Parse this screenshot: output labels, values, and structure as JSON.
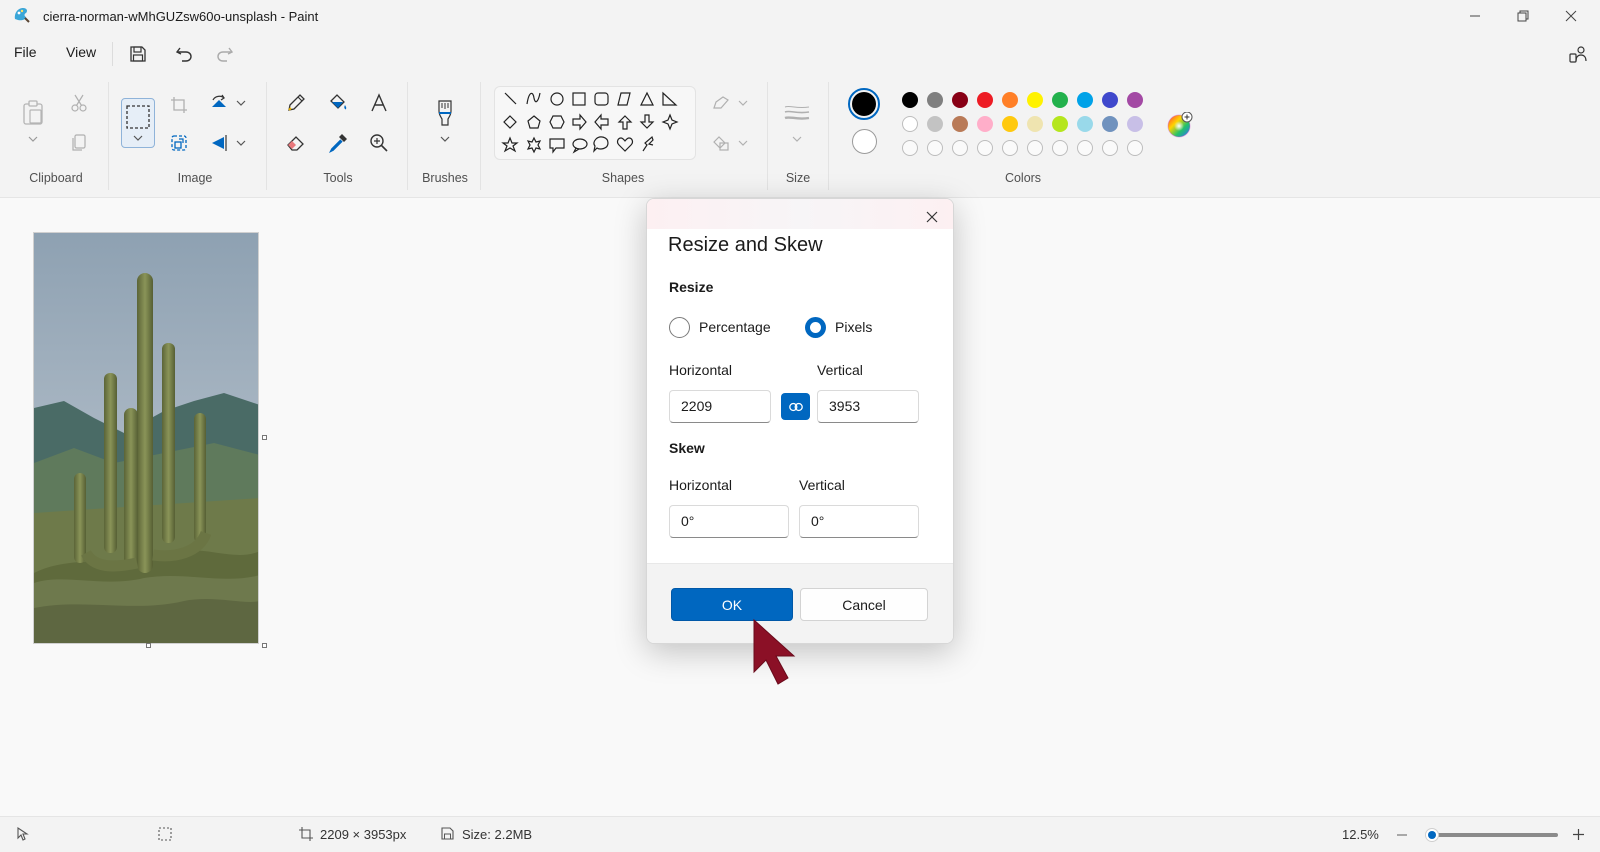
{
  "window": {
    "title": "cierra-norman-wMhGUZsw60o-unsplash - Paint"
  },
  "menu": {
    "file": "File",
    "view": "View"
  },
  "ribbon": {
    "groups": {
      "clipboard": "Clipboard",
      "image": "Image",
      "tools": "Tools",
      "brushes": "Brushes",
      "shapes": "Shapes",
      "size": "Size",
      "colors": "Colors"
    },
    "colors": {
      "primary": "#000000",
      "secondary": "#ffffff",
      "row1": [
        "#000000",
        "#7f7f7f",
        "#880015",
        "#ed1c24",
        "#ff7f27",
        "#fff200",
        "#22b14c",
        "#00a2e8",
        "#3f48cc",
        "#a349a4"
      ],
      "row2": [
        "#ffffff",
        "#c3c3c3",
        "#b97a57",
        "#ffaec9",
        "#ffc90e",
        "#efe4b0",
        "#b5e61d",
        "#99d9ea",
        "#7092be",
        "#c8bfe7"
      ]
    }
  },
  "dialog": {
    "title": "Resize and Skew",
    "resize_label": "Resize",
    "option_percentage": "Percentage",
    "option_pixels": "Pixels",
    "selected_option": "Pixels",
    "resize_horizontal_label": "Horizontal",
    "resize_vertical_label": "Vertical",
    "resize_horizontal_value": "2209",
    "resize_vertical_value": "3953",
    "aspect_locked": true,
    "skew_label": "Skew",
    "skew_horizontal_label": "Horizontal",
    "skew_vertical_label": "Vertical",
    "skew_horizontal_value": "0°",
    "skew_vertical_value": "0°",
    "ok_label": "OK",
    "cancel_label": "Cancel"
  },
  "status": {
    "dimensions": "2209 × 3953px",
    "size": "Size: 2.2MB",
    "zoom": "12.5%",
    "zoom_level": 0.0
  },
  "theme": {
    "accent": "#0067c0",
    "cursor": "#8b1026"
  }
}
